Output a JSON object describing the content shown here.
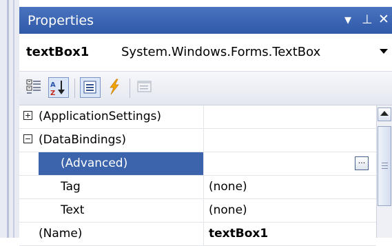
{
  "window": {
    "title": "Properties",
    "dropdown_icon": "▾",
    "pin_icon": "⊥",
    "close_icon": "✕"
  },
  "object_selector": {
    "name": "textBox1",
    "type": "System.Windows.Forms.TextBox"
  },
  "toolbar": {
    "buttons": [
      {
        "icon": "categorized-icon",
        "pressed": false
      },
      {
        "icon": "alphabetical-sort-icon",
        "pressed": true
      },
      {
        "icon": "properties-icon",
        "pressed": true
      },
      {
        "icon": "events-lightning-icon",
        "pressed": false
      },
      {
        "icon": "property-pages-icon",
        "pressed": false
      }
    ],
    "az_label": "AZ"
  },
  "grid": {
    "rows": [
      {
        "name": "(ApplicationSettings)",
        "value": "",
        "expander": "plus"
      },
      {
        "name": "(DataBindings)",
        "value": "",
        "expander": "minus"
      },
      {
        "name": "(Advanced)",
        "value": "",
        "selected": true,
        "ellipsis": "..."
      },
      {
        "name": "Tag",
        "value": "(none)"
      },
      {
        "name": "Text",
        "value": "(none)"
      },
      {
        "name": "(Name)",
        "value": "textBox1",
        "value_bold": true
      }
    ]
  },
  "colors": {
    "titlebar": "#3864b2",
    "selection": "#3b64ad",
    "accent_lightning": "#f2a400"
  }
}
